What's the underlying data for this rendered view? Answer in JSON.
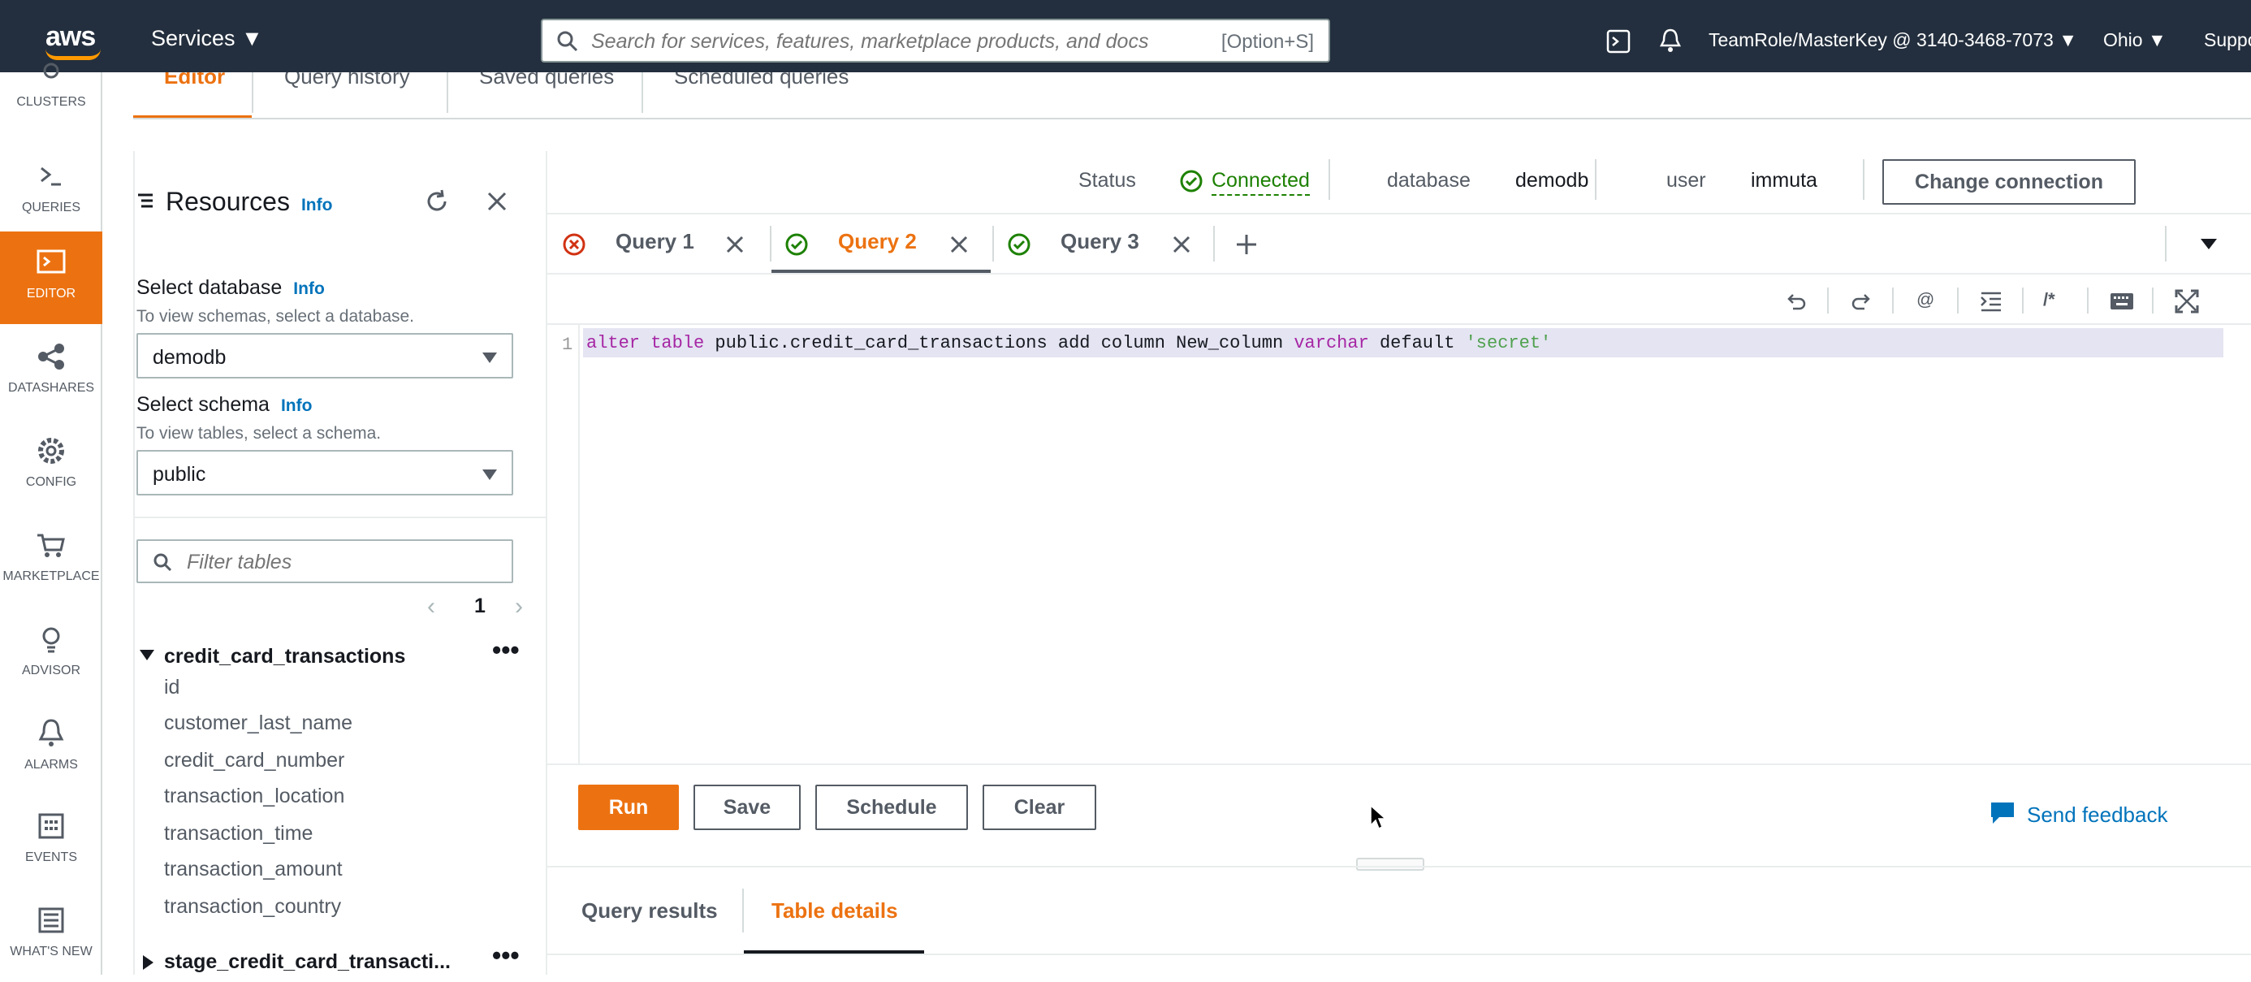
{
  "topnav": {
    "logo": "aws",
    "services": "Services",
    "search_placeholder": "Search for services, features, marketplace products, and docs",
    "search_shortcut": "[Option+S]",
    "account": "TeamRole/MasterKey @ 3140-3468-7073",
    "region": "Ohio",
    "support": "Suppo"
  },
  "rail": [
    {
      "label": "CLUSTERS",
      "icon": "clusters-icon"
    },
    {
      "label": "QUERIES",
      "icon": "terminal-icon"
    },
    {
      "label": "EDITOR",
      "icon": "editor-icon",
      "active": true
    },
    {
      "label": "DATASHARES",
      "icon": "share-icon"
    },
    {
      "label": "CONFIG",
      "icon": "gear-icon"
    },
    {
      "label": "MARKETPLACE",
      "icon": "cart-icon"
    },
    {
      "label": "ADVISOR",
      "icon": "bulb-icon"
    },
    {
      "label": "ALARMS",
      "icon": "bell-icon"
    },
    {
      "label": "EVENTS",
      "icon": "calendar-icon"
    },
    {
      "label": "WHAT'S NEW",
      "icon": "news-icon"
    }
  ],
  "editor_tabs": [
    "Editor",
    "Query history",
    "Saved queries",
    "Scheduled queries"
  ],
  "resources": {
    "title": "Resources",
    "info": "Info",
    "db_label": "Select database",
    "db_hint": "To view schemas, select a database.",
    "db_value": "demodb",
    "schema_label": "Select schema",
    "schema_hint": "To view tables, select a schema.",
    "schema_value": "public",
    "filter_placeholder": "Filter tables",
    "page": "1",
    "table1": "credit_card_transactions",
    "columns": [
      "id",
      "customer_last_name",
      "credit_card_number",
      "transaction_location",
      "transaction_time",
      "transaction_amount",
      "transaction_country"
    ],
    "table2": "stage_credit_card_transacti..."
  },
  "status": {
    "label": "Status",
    "value": "Connected",
    "db_label": "database",
    "db_value": "demodb",
    "user_label": "user",
    "user_value": "immuta",
    "change": "Change connection"
  },
  "query_tabs": [
    {
      "label": "Query 1",
      "state": "error"
    },
    {
      "label": "Query 2",
      "state": "ok",
      "active": true
    },
    {
      "label": "Query 3",
      "state": "ok"
    }
  ],
  "editor": {
    "line_no": "1",
    "code": {
      "kw1": "alter table",
      "t1": " public.credit_card_transactions add column New_column ",
      "kw2": "varchar",
      "t2": " default ",
      "str": "'secret'"
    }
  },
  "actions": {
    "run": "Run",
    "save": "Save",
    "schedule": "Schedule",
    "clear": "Clear",
    "feedback": "Send feedback"
  },
  "results_tabs": [
    {
      "label": "Query results"
    },
    {
      "label": "Table details",
      "active": true
    }
  ],
  "colors": {
    "accent": "#ec7211",
    "nav": "#232f3e",
    "link": "#0073bb",
    "ok": "#1d8102",
    "err": "#d13212"
  }
}
